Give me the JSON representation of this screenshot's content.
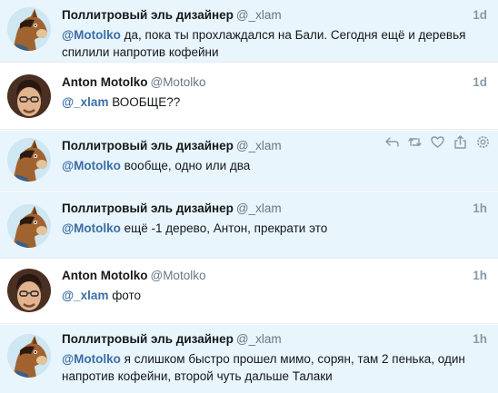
{
  "tweets": [
    {
      "name": "Поллитровый эль дизайнер",
      "handle": "@_xlam",
      "time": "1d",
      "mention": "@Motolko",
      "text": " да, пока ты прохлаждался на Бали. Сегодня ещё и деревья спилили напротив кофейни",
      "avatar": "horse-avatar"
    },
    {
      "name": "Anton Motolko",
      "handle": "@Motolko",
      "time": "1d",
      "mention": "@_xlam",
      "text": " ВООБЩЕ??",
      "avatar": "person-avatar"
    },
    {
      "name": "Поллитровый эль дизайнер",
      "handle": "@_xlam",
      "time": "",
      "mention": "@Motolko",
      "text": " вообще, одно или два",
      "avatar": "horse-avatar",
      "actions": [
        "reply-icon",
        "retweet-icon",
        "like-icon",
        "share-icon",
        "settings-icon"
      ]
    },
    {
      "name": "Поллитровый эль дизайнер",
      "handle": "@_xlam",
      "time": "1h",
      "mention": "@Motolko",
      "text": " ещё -1 дерево, Антон, прекрати это",
      "avatar": "horse-avatar"
    },
    {
      "name": "Anton Motolko",
      "handle": "@Motolko",
      "time": "1h",
      "mention": "@_xlam",
      "text": " фото",
      "avatar": "person-avatar"
    },
    {
      "name": "Поллитровый эль дизайнер",
      "handle": "@_xlam",
      "time": "1h",
      "mention": "@Motolko",
      "text": " я слишком быстро прошел мимо, сорян, там 2 пенька, один напротив кофейни, второй чуть дальше Талаки",
      "avatar": "horse-avatar"
    }
  ],
  "colors": {
    "highlight_bg": "#e8f5fd",
    "mention": "#3b6ea5",
    "handle": "#657786",
    "time": "#8899a6"
  }
}
